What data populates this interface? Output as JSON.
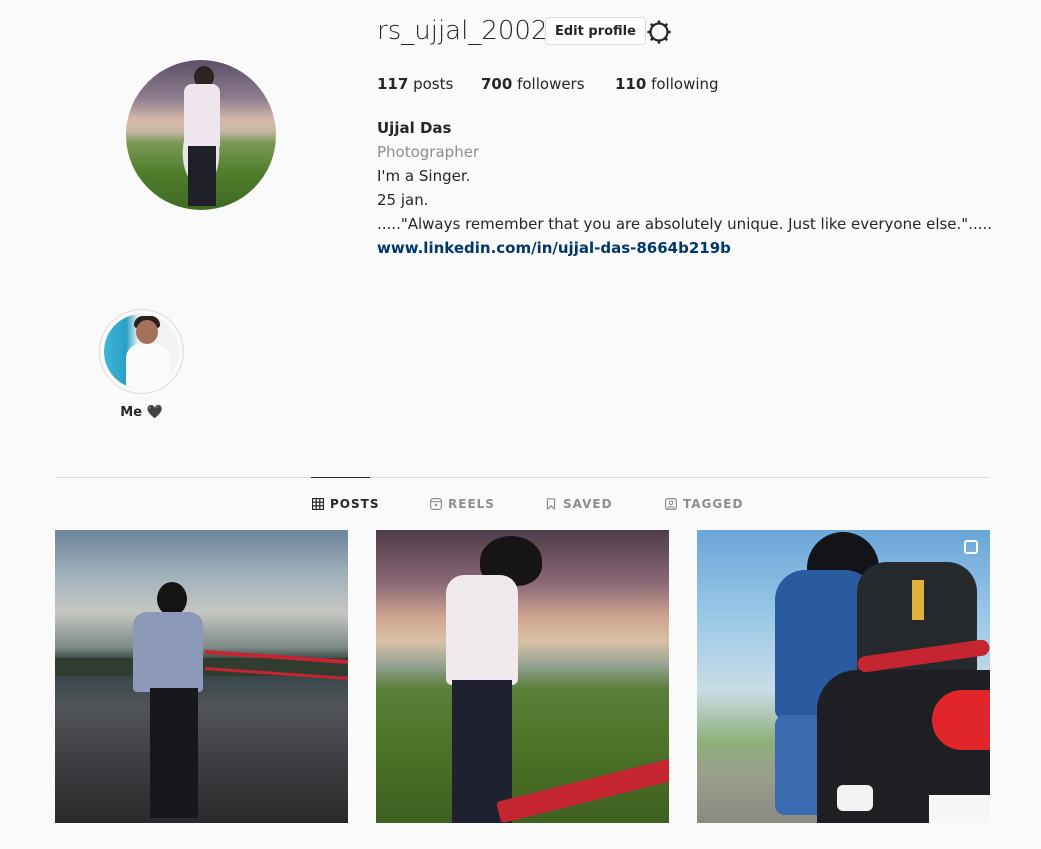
{
  "profile": {
    "username": "rs_ujjal_2002",
    "edit_profile_label": "Edit profile",
    "stats": {
      "posts_count": "117",
      "posts_label": "posts",
      "followers_count": "700",
      "followers_label": "followers",
      "following_count": "110",
      "following_label": "following"
    },
    "bio": {
      "name": "Ujjal Das",
      "category": "Photographer",
      "line1": "I'm a Singer.",
      "line2": "25 jan.",
      "line3": ".....\"Always remember that you are absolutely unique. Just like everyone else.\".....",
      "link": "www.linkedin.com/in/ujjal-das-8664b219b"
    }
  },
  "highlights": [
    {
      "label": "Me 🖤"
    }
  ],
  "tabs": [
    {
      "label": "POSTS",
      "icon": "grid-icon",
      "active": true
    },
    {
      "label": "REELS",
      "icon": "reels-icon",
      "active": false
    },
    {
      "label": "SAVED",
      "icon": "bookmark-icon",
      "active": false
    },
    {
      "label": "TAGGED",
      "icon": "tagged-icon",
      "active": false
    }
  ],
  "posts": [
    {
      "icon": null
    },
    {
      "icon": null
    },
    {
      "icon": "carousel-icon"
    }
  ],
  "colors": {
    "background": "#fafafa",
    "text": "#262626",
    "secondary_text": "#8e8e8e",
    "link": "#00376b",
    "border": "#dbdbdb"
  }
}
